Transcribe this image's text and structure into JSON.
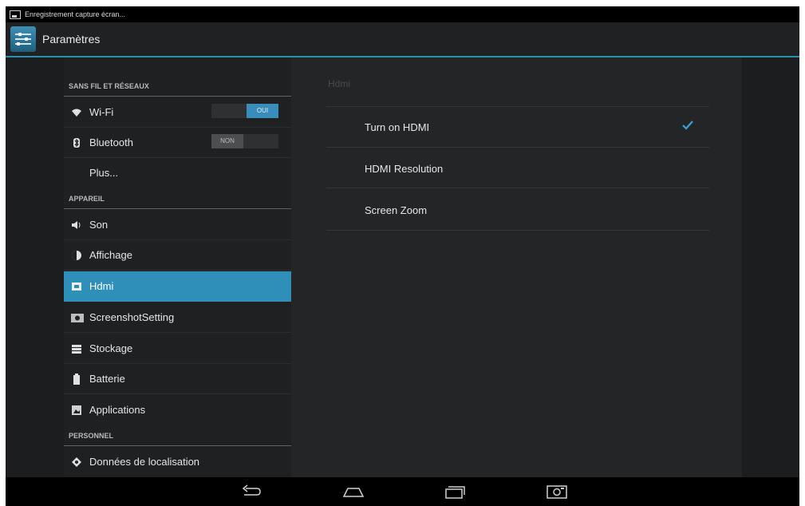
{
  "status_bar": {
    "notification": "Enregistrement capture écran..."
  },
  "action_bar": {
    "title": "Paramètres",
    "icon": "settings-icon"
  },
  "sidebar": {
    "headers": [
      "SANS FIL ET RÉSEAUX",
      "APPAREIL",
      "PERSONNEL"
    ],
    "items": [
      {
        "label": "Wi-Fi",
        "icon": "wifi-icon",
        "toggle": "OUI",
        "toggle_state": "on"
      },
      {
        "label": "Bluetooth",
        "icon": "bluetooth-icon",
        "toggle": "NON",
        "toggle_state": "off"
      },
      {
        "label": "Plus...",
        "icon": ""
      },
      {
        "label": "Son",
        "icon": "volume-icon"
      },
      {
        "label": "Affichage",
        "icon": "brightness-icon"
      },
      {
        "label": "Hdmi",
        "icon": "hdmi-icon",
        "selected": true
      },
      {
        "label": "ScreenshotSetting",
        "icon": "camera-icon"
      },
      {
        "label": "Stockage",
        "icon": "storage-icon"
      },
      {
        "label": "Batterie",
        "icon": "battery-icon"
      },
      {
        "label": "Applications",
        "icon": "apps-icon"
      },
      {
        "label": "Données de localisation",
        "icon": "location-icon"
      }
    ]
  },
  "detail": {
    "title": "Hdmi",
    "items": [
      {
        "label": "Turn on HDMI",
        "checked": true
      },
      {
        "label": "HDMI Resolution"
      },
      {
        "label": "Screen Zoom"
      }
    ]
  },
  "nav_bar": {
    "buttons": [
      "back-icon",
      "home-icon",
      "recents-icon",
      "screenshot-icon"
    ]
  },
  "colors": {
    "accent": "#2f8fb8",
    "background": "#1c1d1f",
    "check": "#3aa3d4"
  }
}
